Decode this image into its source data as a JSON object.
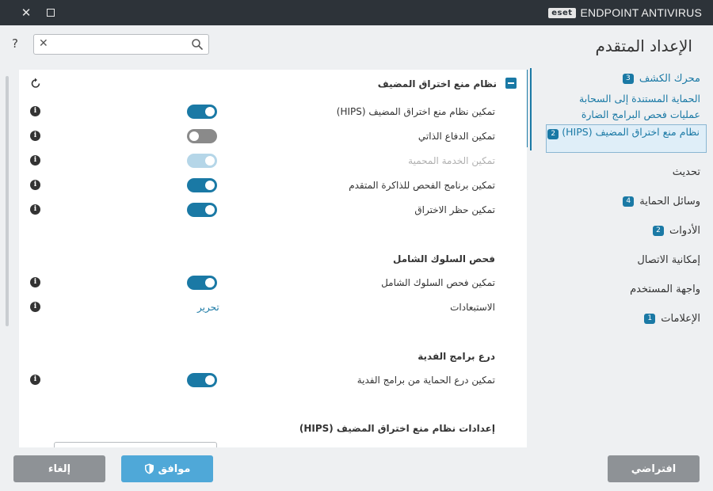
{
  "window": {
    "brand_logo": "eset",
    "product_name": "ENDPOINT ANTIVIRUS",
    "close_icon": "close-icon",
    "maximize_icon": "maximize-icon"
  },
  "header": {
    "title": "الإعداد المتقدم",
    "help_icon": "?",
    "search_value": "",
    "search_placeholder": ""
  },
  "sidebar": {
    "items": [
      {
        "label": "محرك الكشف",
        "badge": "3"
      },
      {
        "label": "تحديث",
        "badge": ""
      },
      {
        "label": "وسائل الحماية",
        "badge": "4"
      },
      {
        "label": "الأدوات",
        "badge": "2"
      },
      {
        "label": "إمكانية الاتصال",
        "badge": ""
      },
      {
        "label": "واجهة المستخدم",
        "badge": ""
      },
      {
        "label": "الإعلامات",
        "badge": "1"
      }
    ],
    "subitems": [
      {
        "label": "الحماية المستندة إلى السحابة"
      },
      {
        "label": "عمليات فحص البرامج الضارة"
      },
      {
        "label": "نظام منع اختراق المضيف (HIPS)",
        "badge": "2"
      }
    ]
  },
  "main": {
    "section_title": "نظام منع اختراق المضيف",
    "rows": [
      {
        "label": "تمكين نظام منع اختراق المضيف (HIPS)",
        "enabled": true,
        "state": "on"
      },
      {
        "label": "تمكين الدفاع الذاتي",
        "enabled": false,
        "state": "off"
      },
      {
        "label": "تمكين الخدمة المحمية",
        "enabled": true,
        "state": "disabled"
      },
      {
        "label": "تمكين برنامج الفحص للذاكرة المتقدم",
        "enabled": true,
        "state": "on"
      },
      {
        "label": "تمكين حظر الاختراق",
        "enabled": true,
        "state": "on"
      }
    ],
    "behavior": {
      "title": "فحص السلوك الشامل",
      "enable_label": "تمكين فحص السلوك الشامل",
      "enabled": true,
      "exclusions_label": "الاستبعادات",
      "edit_link": "تحرير"
    },
    "ransomware": {
      "title": "درع برامج الفدية",
      "enable_label": "تمكين درع الحماية من برامج الفدية",
      "enabled": true
    },
    "hips_settings": {
      "title": "إعدادات نظام منع اختراق المضيف (HIPS)"
    }
  },
  "footer": {
    "cancel_label": "إلغاء",
    "ok_label": "موافق",
    "default_label": "افتراضي"
  },
  "colors": {
    "accent": "#1a79a5",
    "titlebar": "#2d3339",
    "ok_button": "#4fa8d8",
    "gray_button": "#8e9296"
  }
}
